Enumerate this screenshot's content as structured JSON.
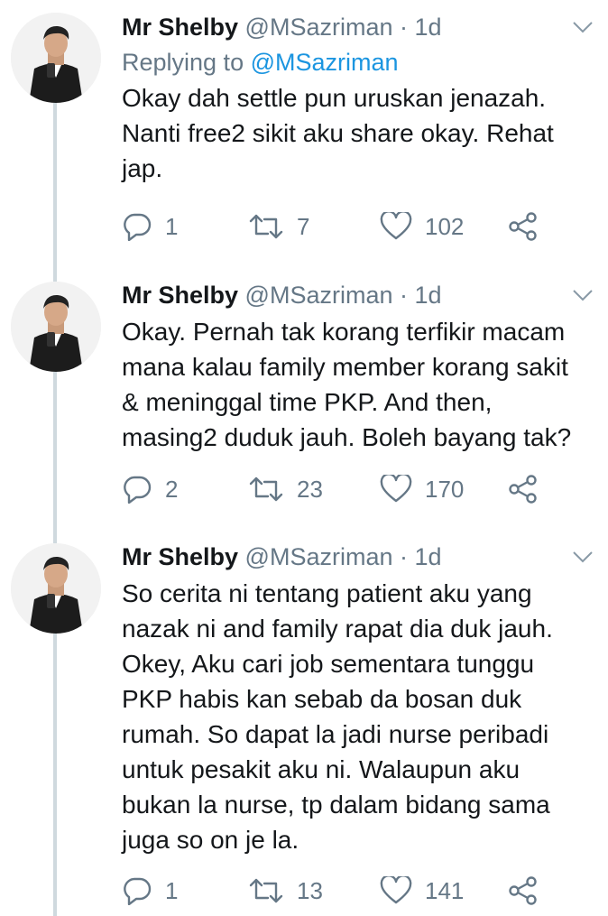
{
  "tweets": [
    {
      "name": "Mr Shelby",
      "handle": "@MSazriman",
      "dot": "·",
      "time": "1d",
      "reply_prefix": "Replying to ",
      "reply_to": "@MSazriman",
      "text": "Okay dah settle pun uruskan jenazah.\nNanti free2 sikit aku share okay. Rehat\njap.",
      "replies": "1",
      "retweets": "7",
      "likes": "102"
    },
    {
      "name": "Mr Shelby",
      "handle": "@MSazriman",
      "dot": "·",
      "time": "1d",
      "text": "Okay. Pernah tak korang terfikir macam\nmana kalau family member korang sakit\n& meninggal time PKP. And then,\nmasing2 duduk jauh. Boleh bayang tak?",
      "replies": "2",
      "retweets": "23",
      "likes": "170"
    },
    {
      "name": "Mr Shelby",
      "handle": "@MSazriman",
      "dot": "·",
      "time": "1d",
      "text": "So cerita ni tentang patient aku yang\nnazak ni and family rapat dia duk jauh.\nOkey, Aku cari job sementara tunggu\nPKP habis kan sebab da bosan duk\nrumah. So dapat la jadi nurse peribadi\nuntuk pesakit aku ni. Walaupun aku\nbukan la nurse, tp dalam bidang sama\njuga so on je la.",
      "replies": "1",
      "retweets": "13",
      "likes": "141"
    }
  ],
  "colors": {
    "text": "#14171a",
    "secondary": "#657786",
    "link": "#1b95e0",
    "thread_line": "#cfd9de"
  },
  "icons": [
    "chevron-down-icon",
    "reply-icon",
    "retweet-icon",
    "like-icon",
    "share-icon"
  ]
}
